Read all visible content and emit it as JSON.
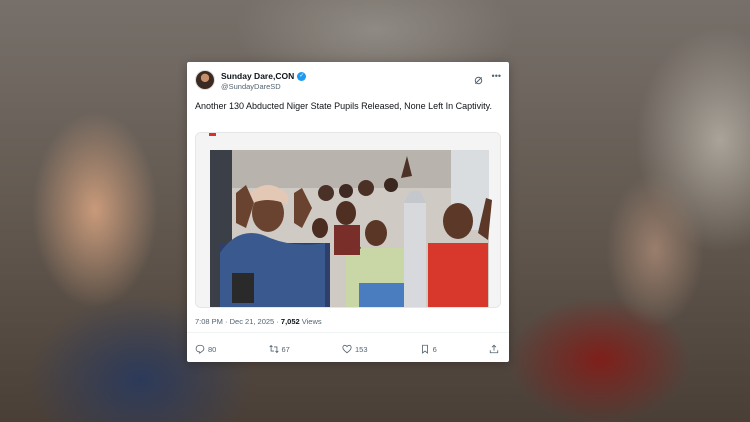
{
  "tweet": {
    "display_name": "Sunday Dare,CON",
    "handle": "@SundayDareSD",
    "verified_icon": "verified-badge-icon",
    "text": "Another 130 Abducted Niger State Pupils Released, None Left In Captivity.",
    "time": "7:08 PM",
    "date_sep": " · ",
    "date": "Dec 21, 2025",
    "views_count": "7,052",
    "views_label": " Views",
    "replies": "80",
    "reposts": "67",
    "likes": "153",
    "bookmarks": "6"
  },
  "colors": {
    "accent": "#1d9bf0",
    "text_primary": "#0f1419",
    "text_secondary": "#536471"
  }
}
